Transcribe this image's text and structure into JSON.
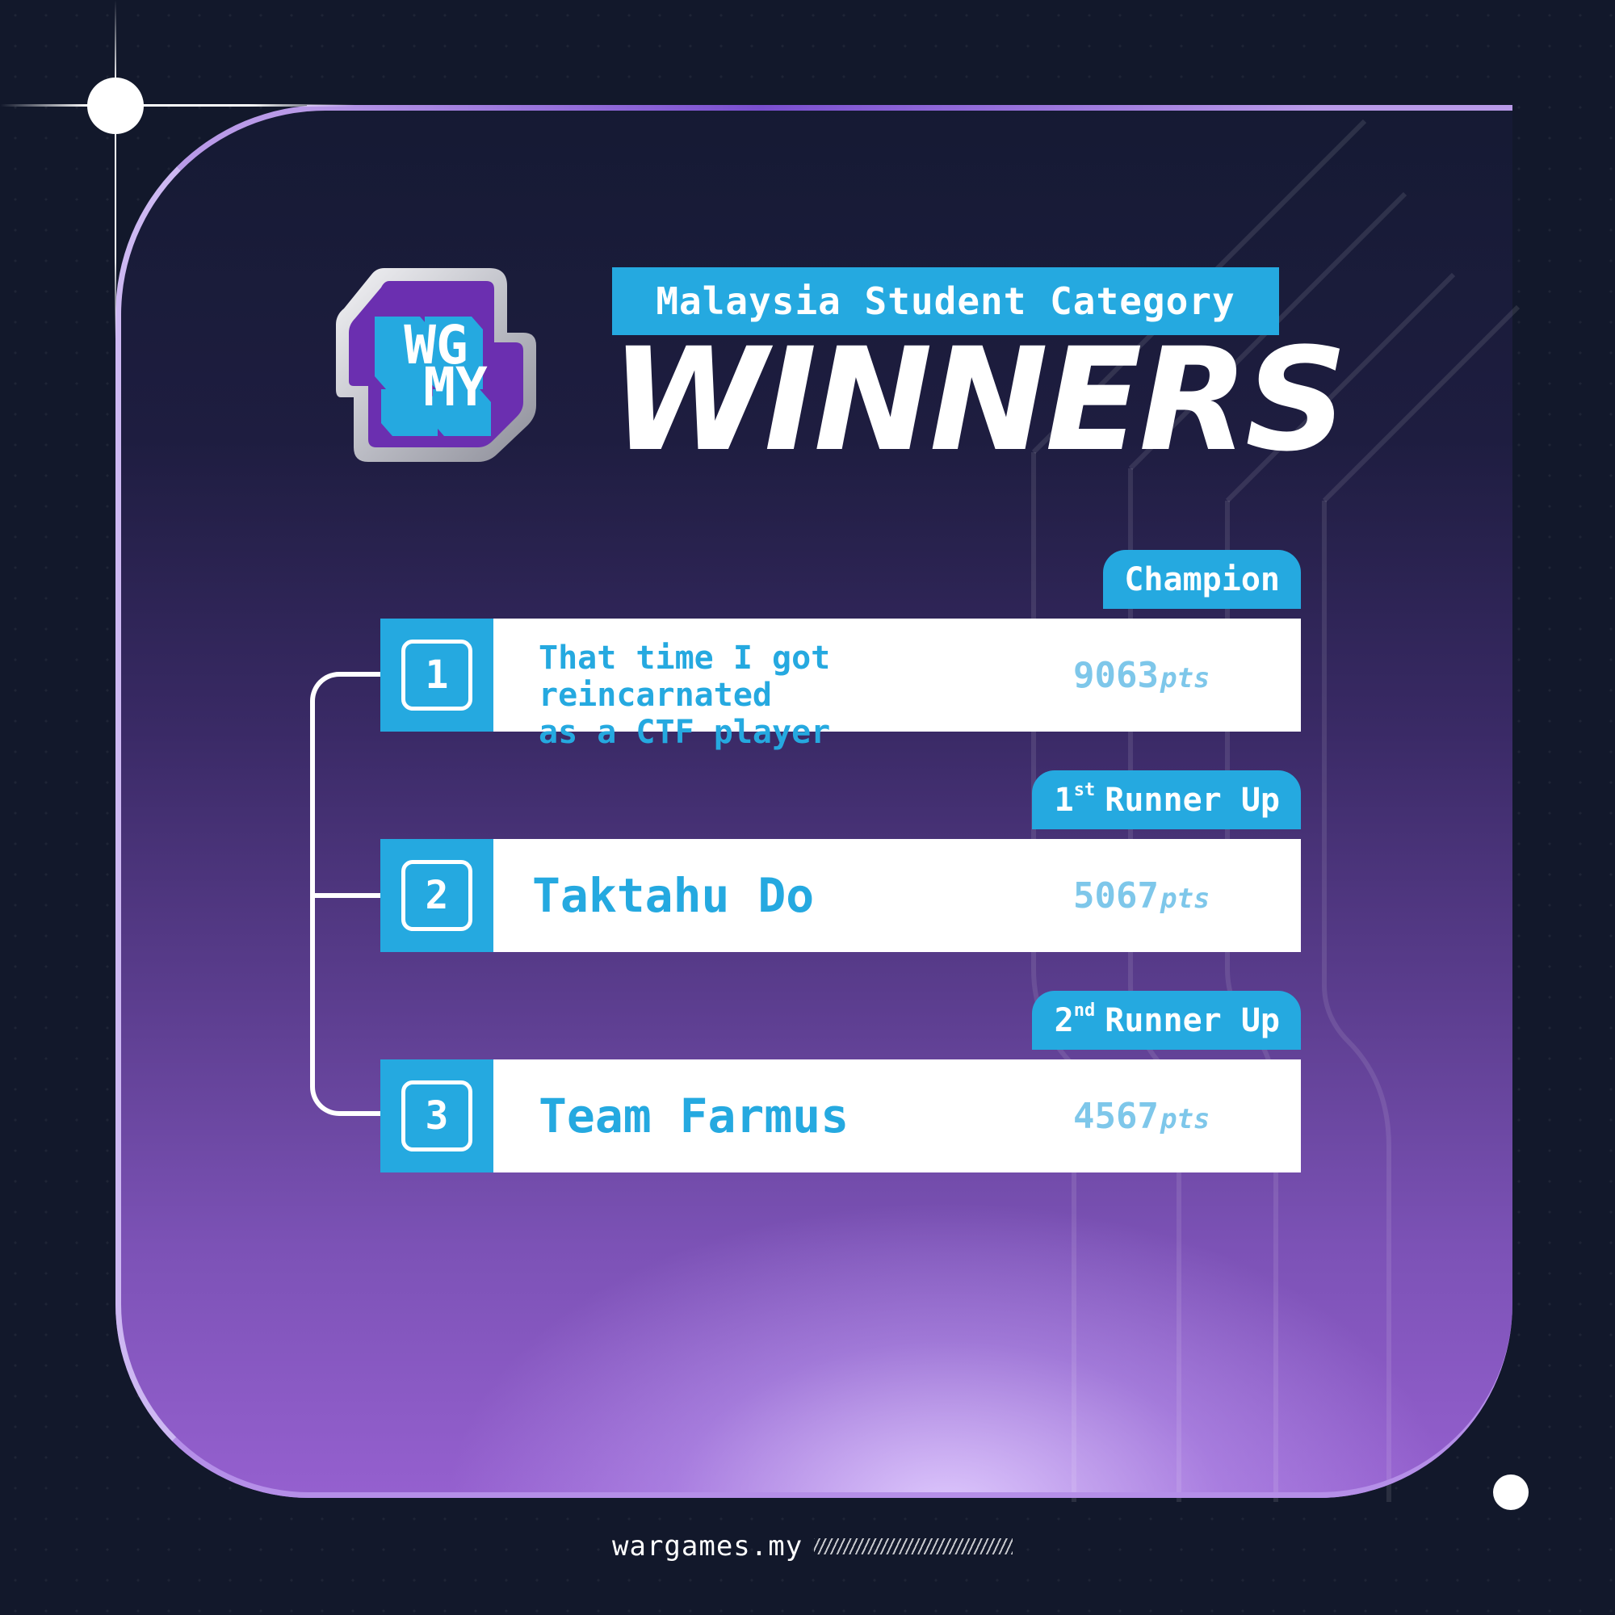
{
  "logo": {
    "line1": "WG",
    "line2": "MY"
  },
  "header": {
    "subtitle": "Malaysia Student Category",
    "title": "WINNERS"
  },
  "winners": [
    {
      "rank": "1",
      "tag": "Champion",
      "team_line1": "That time I got reincarnated",
      "team_line2": "as a CTF player",
      "points": "9063",
      "unit": "pts"
    },
    {
      "rank": "2",
      "tag_num": "1",
      "tag_sup": "st",
      "tag_text": "Runner Up",
      "team": "Taktahu Do",
      "points": "5067",
      "unit": "pts"
    },
    {
      "rank": "3",
      "tag_num": "2",
      "tag_sup": "nd",
      "tag_text": "Runner Up",
      "team": "Team Farmus",
      "points": "4567",
      "unit": "pts"
    }
  ],
  "footer": {
    "site": "wargames.my"
  },
  "colors": {
    "accent": "#25a9e0",
    "background": "#12182b",
    "panel_bottom": "#9560cf"
  }
}
